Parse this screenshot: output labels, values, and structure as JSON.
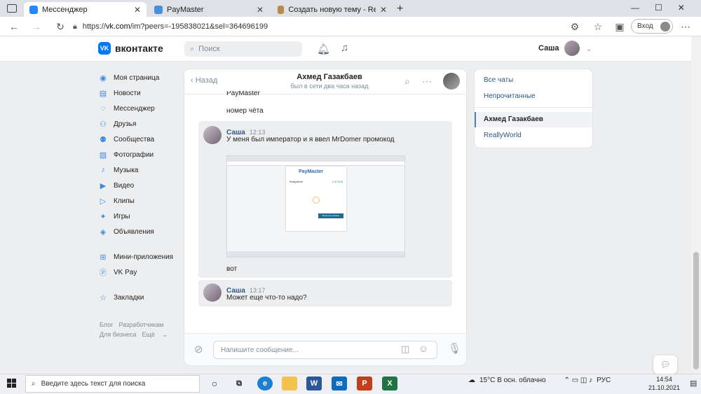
{
  "browser": {
    "tabs": [
      {
        "title": "Мессенджер",
        "color": "#2787f5"
      },
      {
        "title": "PayMaster",
        "color": "#4a90d9"
      },
      {
        "title": "Создать новую тему - ReallyWo",
        "color": "#b58a4a"
      }
    ],
    "new_tab": "+",
    "url_prefix": "https://",
    "url_host": "vk.com",
    "url_path": "/im?peers=-195838021&sel=364696199",
    "login_label": "Вход"
  },
  "vk": {
    "logo_text": "вконтакте",
    "logo_mark": "VK",
    "search_placeholder": "Поиск",
    "user_name": "Саша"
  },
  "left_nav": {
    "items": [
      {
        "label": "Моя страница",
        "icon": "user-circle-icon"
      },
      {
        "label": "Новости",
        "icon": "newspaper-icon"
      },
      {
        "label": "Мессенджер",
        "icon": "chat-bubble-icon"
      },
      {
        "label": "Друзья",
        "icon": "friends-icon"
      },
      {
        "label": "Сообщества",
        "icon": "communities-icon"
      },
      {
        "label": "Фотографии",
        "icon": "photo-icon"
      },
      {
        "label": "Музыка",
        "icon": "music-icon"
      },
      {
        "label": "Видео",
        "icon": "video-icon"
      },
      {
        "label": "Клипы",
        "icon": "clips-icon"
      },
      {
        "label": "Игры",
        "icon": "games-icon"
      },
      {
        "label": "Объявления",
        "icon": "ads-icon"
      }
    ],
    "items2": [
      {
        "label": "Мини-приложения",
        "icon": "apps-icon"
      },
      {
        "label": "VK Pay",
        "icon": "vkpay-icon"
      }
    ],
    "items3": [
      {
        "label": "Закладки",
        "icon": "star-icon"
      }
    ],
    "footer": {
      "blog": "Блог",
      "dev": "Разработчикам",
      "business": "Для бизнеса",
      "more": "Ещё"
    }
  },
  "chat": {
    "back_label": "Назад",
    "peer_name": "Ахмед Газакбаев",
    "peer_status": "был в сети два часа назад",
    "messages": {
      "cut_text": "PayMaster",
      "m0_text": "номер чёта",
      "m1_author": "Саша",
      "m1_time": "12:13",
      "m1_text": "У меня был император и я ввел MrDomer промокод",
      "m1_after": "вот",
      "m2_author": "Саша",
      "m2_time": "13:17",
      "m2_text": "Может еще что-то надо?"
    },
    "attachment": {
      "brand": "PayMaster",
      "merchant": "ReallyWorld",
      "amount": "5 00 RUB",
      "button": "Вернуться в магазин"
    },
    "composer_placeholder": "Напишите сообщение..."
  },
  "filters": {
    "all": "Все чаты",
    "unread": "Непрочитанные",
    "active": "Ахмед Газакбаев",
    "other": "ReallyWorld"
  },
  "taskbar": {
    "search_placeholder": "Введите здесь текст для поиска",
    "weather": "15°C В осн. облачно",
    "lang": "РУС",
    "time": "14:54",
    "date": "21.10.2021"
  }
}
